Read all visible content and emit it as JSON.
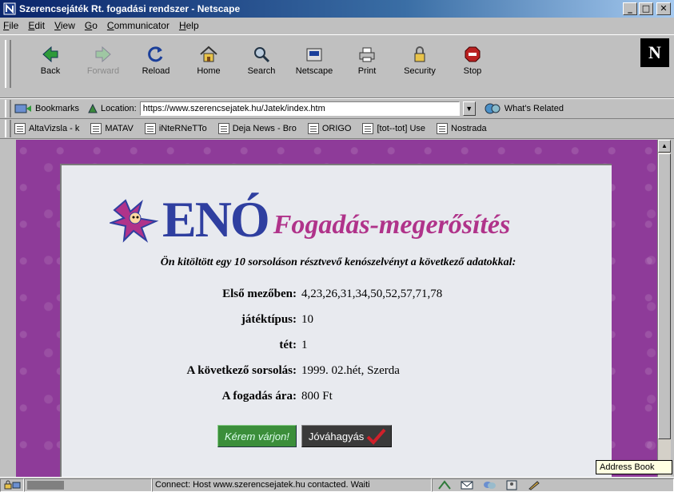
{
  "window": {
    "title": "Szerencsejáték Rt. fogadási rendszer - Netscape",
    "controls": [
      "_",
      "□",
      "✕"
    ]
  },
  "menu": [
    "File",
    "Edit",
    "View",
    "Go",
    "Communicator",
    "Help"
  ],
  "nav": {
    "back": "Back",
    "forward": "Forward",
    "reload": "Reload",
    "home": "Home",
    "search": "Search",
    "netscape": "Netscape",
    "print": "Print",
    "security": "Security",
    "stop": "Stop"
  },
  "location": {
    "bookmarks": "Bookmarks",
    "label": "Location:",
    "url": "https://www.szerencsejatek.hu/Jatek/index.htm",
    "related": "What's Related"
  },
  "personal": [
    "AltaVizsla - k",
    "MATAV",
    "iNteRNeTTo",
    "Deja News - Bro",
    "ORIGO",
    "[tot--tot] Use",
    "Nostrada"
  ],
  "page": {
    "logo": "ENÓ",
    "heading": "Fogadás-megerősítés",
    "intro": "Ön kitöltött egy 10 sorsoláson résztvevő kenószelvényt a következő adatokkal:",
    "fields": [
      {
        "label": "Első mezőben:",
        "value": "4,23,26,31,34,50,52,57,71,78"
      },
      {
        "label": "játéktípus:",
        "value": "10"
      },
      {
        "label": "tét:",
        "value": "1"
      },
      {
        "label": "A következő sorsolás:",
        "value": "1999. 02.hét, Szerda"
      },
      {
        "label": "A fogadás ára:",
        "value": "800 Ft"
      }
    ],
    "wait_button": "Kérem várjon!",
    "confirm_button": "Jóváhagyás"
  },
  "tooltip": "Address Book",
  "status": {
    "text": "Connect: Host www.szerencsejatek.hu contacted. Waiti",
    "progress": 0.3
  },
  "colors": {
    "background": "#8e3b99",
    "heading": "#b0338a",
    "logo": "#2f3fa0",
    "wait_button": "#3b8e3a"
  }
}
